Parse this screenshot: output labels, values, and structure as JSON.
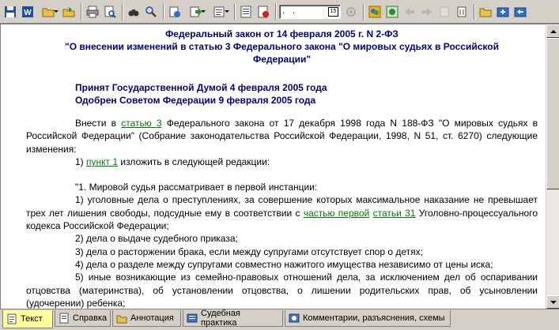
{
  "toolbar": {
    "date_field": {
      "value": ". .",
      "calendar_label": "15"
    },
    "icons": [
      "save-icon",
      "word-icon",
      "open-folder-icon",
      "export-icon",
      "print-icon",
      "preview-icon",
      "find-icon",
      "search-icon",
      "copy-to-icon",
      "send-to-icon",
      "document-icon",
      "stop-icon",
      "settings-icon",
      "status-icon",
      "back-icon",
      "forward-icon",
      "list-icon",
      "attach-icon",
      "folder-icon",
      "add-icon",
      "save-list-icon"
    ]
  },
  "document": {
    "title_lines": [
      "Федеральный закон от 14 февраля 2005 г. N 2-ФЗ",
      "\"О внесении изменений в статью 3 Федерального закона \"О мировых судьях в Российской",
      "Федерации\""
    ],
    "accepted": [
      "Принят Государственной Думой 4 февраля 2005 года",
      "Одобрен Советом Федерации 9 февраля 2005 года"
    ],
    "para1": {
      "before": "Внести в ",
      "link": "статью 3",
      "after": " Федерального закона от 17 декабря 1998 года N 188-ФЗ \"О мировых судьях в Российской Федерации\" (Собрание законодательства Российской Федерации, 1998, N 51, ст. 6270) следующие изменения:"
    },
    "para2": {
      "before": "1) ",
      "link": "пункт 1",
      "after": " изложить в следующей редакции:"
    },
    "para3": "\"1. Мировой судья рассматривает в первой инстанции:",
    "para4": {
      "before": "1) уголовные дела о преступлениях, за совершение которых максимальное наказание не превышает трех лет лишения свободы, подсудные ему в соответствии с ",
      "link1": "частью первой",
      "mid": " ",
      "link2": "статьи 31",
      "after": " Уголовно-процессуального кодекса Российской Федерации;"
    },
    "para5": "2) дела о выдаче судебного приказа;",
    "para6": "3) дела о расторжении брака, если между супругами отсутствует спор о детях;",
    "para7": "4) дела о разделе между супругами совместно нажитого имущества независимо от цены иска;",
    "para8": "5) иные возникающие из семейно-правовых отношений дела, за исключением дел об оспаривании отцовства (материнства), об установлении отцовства, о лишении родительских прав, об усыновлении (удочерении) ребенка;"
  },
  "tabs": [
    {
      "label": "Текст",
      "icon": "text-page-icon",
      "active": true
    },
    {
      "label": "Справка",
      "icon": "info-page-icon",
      "active": false
    },
    {
      "label": "Аннотация",
      "icon": "folder-annotation-icon",
      "active": false
    },
    {
      "label": "Судебная практика",
      "icon": "court-practice-icon",
      "active": false
    },
    {
      "label": "Комментарии, разъяснения, схемы",
      "icon": "comments-icon",
      "active": false
    }
  ],
  "colors": {
    "title": "#00007f",
    "link": "#007f00",
    "active_tab": "#ffff99",
    "chrome": "#d4d0c8"
  }
}
